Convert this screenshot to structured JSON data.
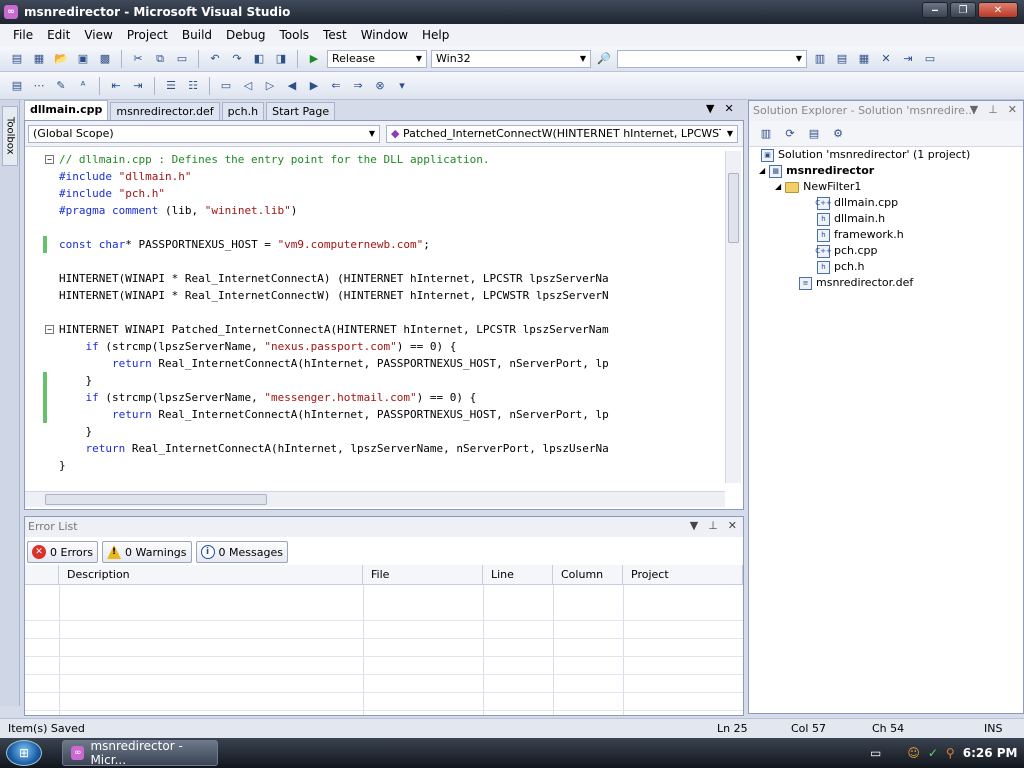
{
  "window": {
    "title": "msnredirector - Microsoft Visual Studio",
    "minimize": "‒",
    "maximize": "❐",
    "close": "✕"
  },
  "menu": [
    "File",
    "Edit",
    "View",
    "Project",
    "Build",
    "Debug",
    "Tools",
    "Test",
    "Window",
    "Help"
  ],
  "toolbar": {
    "configuration": "Release",
    "platform": "Win32"
  },
  "toolbox": {
    "label": "Toolbox"
  },
  "editor": {
    "tabs": [
      "dllmain.cpp",
      "msnredirector.def",
      "pch.h",
      "Start Page"
    ],
    "active_tab": "dllmain.cpp",
    "scope": "(Global Scope)",
    "function": "Patched_InternetConnectW(HINTERNET hInternet, LPCWSTR lp",
    "code": [
      {
        "segments": [
          {
            "t": "// dllmain.cpp : Defines the entry point for the DLL application.",
            "c": "cm"
          }
        ]
      },
      {
        "segments": [
          {
            "t": "#include ",
            "c": "pp"
          },
          {
            "t": "\"dllmain.h\"",
            "c": "st"
          }
        ]
      },
      {
        "segments": [
          {
            "t": "#include ",
            "c": "pp"
          },
          {
            "t": "\"pch.h\"",
            "c": "st"
          }
        ]
      },
      {
        "segments": [
          {
            "t": "#pragma ",
            "c": "pp"
          },
          {
            "t": "comment",
            "c": "kw"
          },
          {
            "t": " (lib, "
          },
          {
            "t": "\"wininet.lib\"",
            "c": "st"
          },
          {
            "t": ")"
          }
        ]
      },
      {
        "segments": []
      },
      {
        "segments": [
          {
            "t": "const char",
            "c": "kw"
          },
          {
            "t": "* PASSPORTNEXUS_HOST = "
          },
          {
            "t": "\"vm9.computernewb.com\"",
            "c": "st"
          },
          {
            "t": ";"
          }
        ]
      },
      {
        "segments": []
      },
      {
        "segments": [
          {
            "t": "HINTERNET(WINAPI * Real_InternetConnectA) (HINTERNET hInternet, LPCSTR lpszServerNa"
          }
        ]
      },
      {
        "segments": [
          {
            "t": "HINTERNET(WINAPI * Real_InternetConnectW) (HINTERNET hInternet, LPCWSTR lpszServerN"
          }
        ]
      },
      {
        "segments": []
      },
      {
        "segments": [
          {
            "t": "HINTERNET WINAPI Patched_InternetConnectA(HINTERNET hInternet, LPCSTR lpszServerNam"
          }
        ]
      },
      {
        "segments": [
          {
            "t": "    "
          },
          {
            "t": "if",
            "c": "kw"
          },
          {
            "t": " (strcmp(lpszServerName, "
          },
          {
            "t": "\"nexus.passport.com\"",
            "c": "st"
          },
          {
            "t": ") == 0) {"
          }
        ]
      },
      {
        "segments": [
          {
            "t": "        "
          },
          {
            "t": "return",
            "c": "kw"
          },
          {
            "t": " Real_InternetConnectA(hInternet, PASSPORTNEXUS_HOST, nServerPort, lp"
          }
        ]
      },
      {
        "segments": [
          {
            "t": "    }"
          }
        ]
      },
      {
        "segments": [
          {
            "t": "    "
          },
          {
            "t": "if",
            "c": "kw"
          },
          {
            "t": " (strcmp(lpszServerName, "
          },
          {
            "t": "\"messenger.hotmail.com\"",
            "c": "st"
          },
          {
            "t": ") == 0) {"
          }
        ]
      },
      {
        "segments": [
          {
            "t": "        "
          },
          {
            "t": "return",
            "c": "kw"
          },
          {
            "t": " Real_InternetConnectA(hInternet, PASSPORTNEXUS_HOST, nServerPort, lp"
          }
        ]
      },
      {
        "segments": [
          {
            "t": "    }"
          }
        ]
      },
      {
        "segments": [
          {
            "t": "    "
          },
          {
            "t": "return",
            "c": "kw"
          },
          {
            "t": " Real_InternetConnectA(hInternet, lpszServerName, nServerPort, lpszUserNa"
          }
        ]
      },
      {
        "segments": [
          {
            "t": "}"
          }
        ]
      }
    ],
    "colors": {
      "keyword": "#1a2fd8",
      "comment": "#1f8a25",
      "string": "#a31515",
      "changed": "#67c06a"
    }
  },
  "error_list": {
    "title": "Error List",
    "errors": "0 Errors",
    "warnings": "0 Warnings",
    "messages": "0 Messages",
    "columns": [
      "Description",
      "File",
      "Line",
      "Column",
      "Project"
    ]
  },
  "solution_explorer": {
    "title": "Solution Explorer - Solution 'msnredire...",
    "solution": "Solution 'msnredirector' (1 project)",
    "project": "msnredirector",
    "filter": "NewFilter1",
    "files": [
      "dllmain.cpp",
      "dllmain.h",
      "framework.h",
      "pch.cpp",
      "pch.h"
    ],
    "def_file": "msnredirector.def"
  },
  "status": {
    "message": "Item(s) Saved",
    "ln": "Ln 25",
    "col": "Col 57",
    "ch": "Ch 54",
    "mode": "INS"
  },
  "taskbar": {
    "task": "msnredirector - Micr...",
    "time": "6:26 PM"
  }
}
